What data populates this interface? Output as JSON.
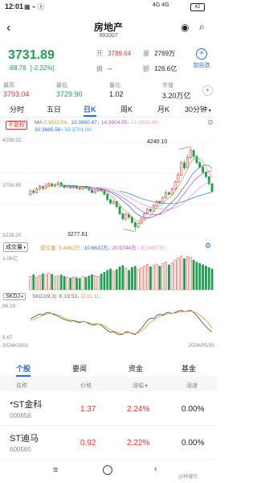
{
  "status": {
    "time": "12:01",
    "signal": "4G 4G",
    "battery": "42"
  },
  "header": {
    "title": "房地产",
    "code": "991007"
  },
  "quote": {
    "price": "3731.89",
    "change": "-88.76",
    "change_pct": "[-2.32%]",
    "open_label": "开",
    "open": "3789.64",
    "volume_label": "量",
    "volume": "2769万",
    "turnover_label": "换",
    "turnover": "--",
    "amount_label": "额",
    "amount": "126.6亿",
    "add_label": "加自选"
  },
  "stats": [
    {
      "label": "最高",
      "value": "3793.04",
      "color": "#e8312f"
    },
    {
      "label": "最低",
      "value": "3729.90",
      "color": "#1ea052"
    },
    {
      "label": "量比",
      "value": "1.02",
      "color": "#222"
    },
    {
      "label": "市值",
      "value": "3.20万亿",
      "color": "#222"
    }
  ],
  "period_tabs": [
    "分时",
    "五日",
    "日K",
    "周K",
    "月K",
    "30分钟"
  ],
  "period_active": "日K",
  "ma_legend": {
    "fq": "不复权",
    "ma": "MA",
    "ma5": "5:3833.56↓",
    "ma10": "10:3960.47↓",
    "ma14": "14:3904.95↓",
    "ma21": "21:3826.88↓",
    "ma30": "30:3685.56↑",
    "ma55": "55:3701.04↑"
  },
  "chart_data": {
    "type": "candlestick",
    "y_top_label": "4298.52",
    "y_mid_label": "3758.85",
    "y_bottom_label": "3219.20",
    "ylim": [
      3219.2,
      4298.52
    ],
    "high_annotation": "4240.10",
    "low_annotation": "3277.61",
    "x_start": "2024/03/01",
    "x_end": "2024/05/30",
    "candles": [
      [
        3700,
        3740,
        3680,
        3760
      ],
      [
        3740,
        3720,
        3700,
        3765
      ],
      [
        3720,
        3760,
        3710,
        3780
      ],
      [
        3760,
        3790,
        3745,
        3810
      ],
      [
        3790,
        3770,
        3750,
        3800
      ],
      [
        3770,
        3800,
        3760,
        3830
      ],
      [
        3800,
        3820,
        3785,
        3840
      ],
      [
        3820,
        3795,
        3780,
        3835
      ],
      [
        3795,
        3810,
        3780,
        3825
      ],
      [
        3810,
        3830,
        3800,
        3850
      ],
      [
        3830,
        3800,
        3790,
        3845
      ],
      [
        3800,
        3780,
        3760,
        3815
      ],
      [
        3780,
        3795,
        3770,
        3810
      ],
      [
        3795,
        3775,
        3760,
        3805
      ],
      [
        3775,
        3790,
        3765,
        3800
      ],
      [
        3790,
        3770,
        3755,
        3800
      ],
      [
        3770,
        3760,
        3745,
        3785
      ],
      [
        3760,
        3780,
        3750,
        3795
      ],
      [
        3780,
        3770,
        3760,
        3790
      ],
      [
        3770,
        3750,
        3735,
        3780
      ],
      [
        3750,
        3720,
        3710,
        3760
      ],
      [
        3720,
        3740,
        3705,
        3755
      ],
      [
        3740,
        3760,
        3730,
        3775
      ],
      [
        3760,
        3740,
        3725,
        3770
      ],
      [
        3740,
        3700,
        3690,
        3750
      ],
      [
        3700,
        3640,
        3620,
        3710
      ],
      [
        3640,
        3600,
        3580,
        3655
      ],
      [
        3600,
        3620,
        3590,
        3640
      ],
      [
        3620,
        3560,
        3540,
        3630
      ],
      [
        3560,
        3480,
        3460,
        3570
      ],
      [
        3480,
        3420,
        3400,
        3500
      ],
      [
        3420,
        3470,
        3400,
        3490
      ],
      [
        3470,
        3440,
        3420,
        3490
      ],
      [
        3440,
        3380,
        3370,
        3455
      ],
      [
        3380,
        3330,
        3277.61,
        3390
      ],
      [
        3330,
        3370,
        3310,
        3385
      ],
      [
        3370,
        3420,
        3360,
        3440
      ],
      [
        3420,
        3480,
        3410,
        3500
      ],
      [
        3480,
        3530,
        3470,
        3550
      ],
      [
        3530,
        3510,
        3495,
        3555
      ],
      [
        3510,
        3570,
        3500,
        3590
      ],
      [
        3570,
        3620,
        3560,
        3640
      ],
      [
        3620,
        3600,
        3585,
        3635
      ],
      [
        3600,
        3660,
        3595,
        3680
      ],
      [
        3660,
        3720,
        3650,
        3740
      ],
      [
        3720,
        3700,
        3690,
        3735
      ],
      [
        3700,
        3760,
        3690,
        3780
      ],
      [
        3760,
        3840,
        3750,
        3860
      ],
      [
        3840,
        3920,
        3830,
        3950
      ],
      [
        3920,
        4060,
        3910,
        4080
      ],
      [
        4060,
        4000,
        3980,
        4090
      ],
      [
        4000,
        4120,
        3990,
        4150
      ],
      [
        4120,
        4200,
        4100,
        4240.1
      ],
      [
        4200,
        4130,
        4100,
        4215
      ],
      [
        4130,
        4060,
        4040,
        4150
      ],
      [
        4060,
        4010,
        3990,
        4080
      ],
      [
        4010,
        3950,
        3930,
        4020
      ],
      [
        3950,
        3900,
        3880,
        3960
      ],
      [
        3900,
        3820,
        3800,
        3910
      ],
      [
        3820,
        3731.89,
        3729.9,
        3835
      ]
    ]
  },
  "volume_legend": {
    "label": "成交量",
    "v": "成交量: 5:4462万↓",
    "v10": "10:6622万↓",
    "v20": "20:5744万↓",
    "v30": "30:4497万↑"
  },
  "volume_data": {
    "top_label": "1.06亿",
    "values": [
      40,
      45,
      38,
      42,
      48,
      44,
      50,
      46,
      39,
      41,
      44,
      40,
      37,
      35,
      38,
      36,
      34,
      39,
      37,
      41,
      45,
      42,
      40,
      47,
      52,
      58,
      62,
      55,
      60,
      68,
      72,
      64,
      58,
      66,
      70,
      60,
      65,
      70,
      75,
      68,
      72,
      76,
      70,
      78,
      82,
      74,
      80,
      88,
      95,
      100,
      92,
      98,
      96,
      88,
      82,
      78,
      74,
      70,
      66,
      62
    ]
  },
  "skdj_legend": {
    "label": "SKDJ",
    "k": "SKDJ(9,3): K:19.53↓",
    "d": "D:31.11↓"
  },
  "skdj_data": {
    "top_label": "86.18",
    "bottom_label": "9.67",
    "k": [
      60,
      65,
      70,
      75,
      72,
      78,
      80,
      76,
      72,
      68,
      62,
      58,
      55,
      52,
      54,
      50,
      48,
      52,
      50,
      45,
      40,
      42,
      44,
      40,
      32,
      24,
      18,
      20,
      14,
      10,
      12,
      20,
      18,
      14,
      11,
      20,
      30,
      42,
      55,
      62,
      60,
      70,
      74,
      72,
      78,
      80,
      76,
      80,
      84,
      86,
      82,
      84,
      86,
      80,
      70,
      58,
      46,
      36,
      26,
      19.53
    ],
    "d": [
      55,
      58,
      62,
      68,
      70,
      73,
      76,
      77,
      75,
      72,
      68,
      63,
      59,
      56,
      55,
      53,
      51,
      51,
      50,
      48,
      45,
      44,
      44,
      42,
      38,
      32,
      26,
      22,
      19,
      15,
      13,
      16,
      17,
      16,
      14,
      16,
      22,
      30,
      40,
      50,
      55,
      62,
      68,
      70,
      73,
      76,
      77,
      78,
      80,
      82,
      82,
      83,
      84,
      82,
      78,
      72,
      64,
      55,
      44,
      31.11
    ]
  },
  "bottom_tabs": [
    "个股",
    "要闻",
    "资金",
    "基金"
  ],
  "bottom_active": "个股",
  "list_head": {
    "name": "名称",
    "price": "价格",
    "change": "涨幅",
    "speed": "涨速"
  },
  "list": [
    {
      "name": "*ST金科",
      "code": "000656",
      "price": "1.37",
      "change": "2.24%",
      "speed": "0.00%"
    },
    {
      "name": "ST迪马",
      "code": "600565",
      "price": "0.92",
      "change": "2.22%",
      "speed": "0.00%"
    }
  ],
  "watermark": "@韩耀玲",
  "colors": {
    "up": "#e8312f",
    "down": "#1ea052",
    "accent": "#2c6ad8"
  }
}
